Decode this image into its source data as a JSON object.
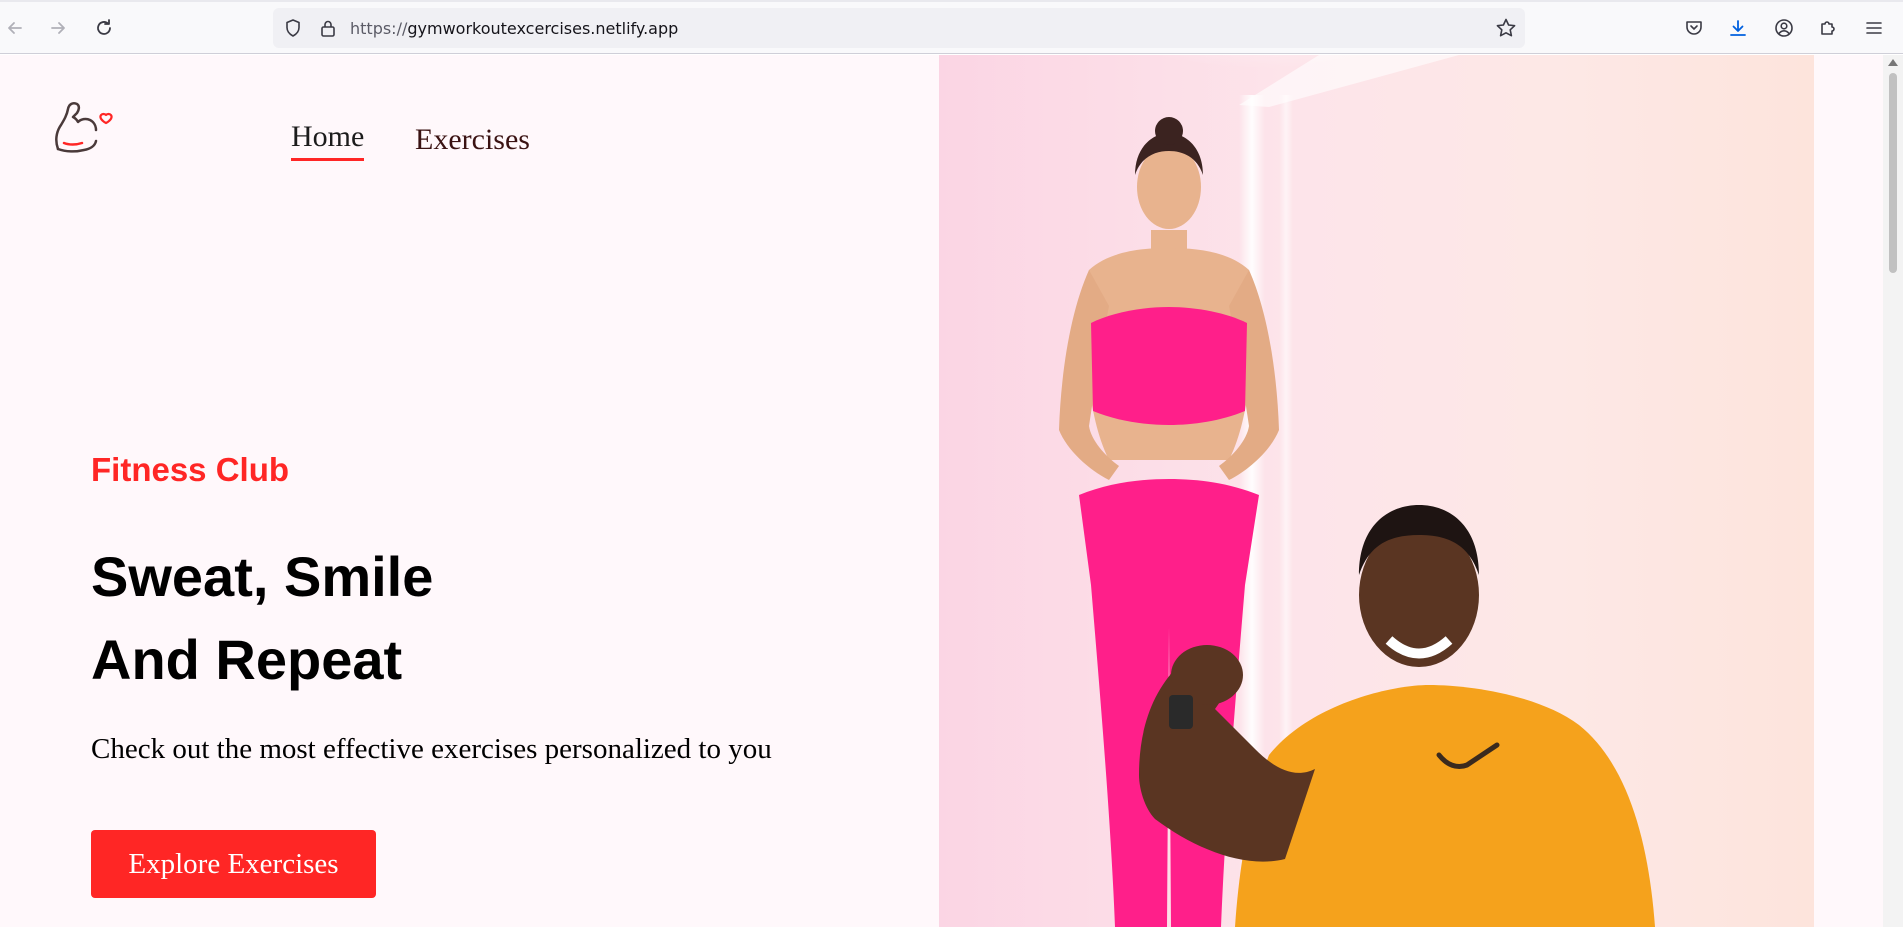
{
  "browser": {
    "url_protocol": "https://",
    "url_host": "gymworkoutexcercises.netlify.app"
  },
  "nav": {
    "home": "Home",
    "exercises": "Exercises"
  },
  "hero": {
    "club": "Fitness Club",
    "headline_line1": "Sweat, Smile",
    "headline_line2": "And Repeat",
    "subtitle": "Check out the most effective exercises personalized to you",
    "button": "Explore Exercises"
  },
  "colors": {
    "accent": "#ff2625",
    "page_background": "#fff8fb",
    "top_color": "#ff1f8a",
    "shirt_color": "#f5a21c"
  }
}
